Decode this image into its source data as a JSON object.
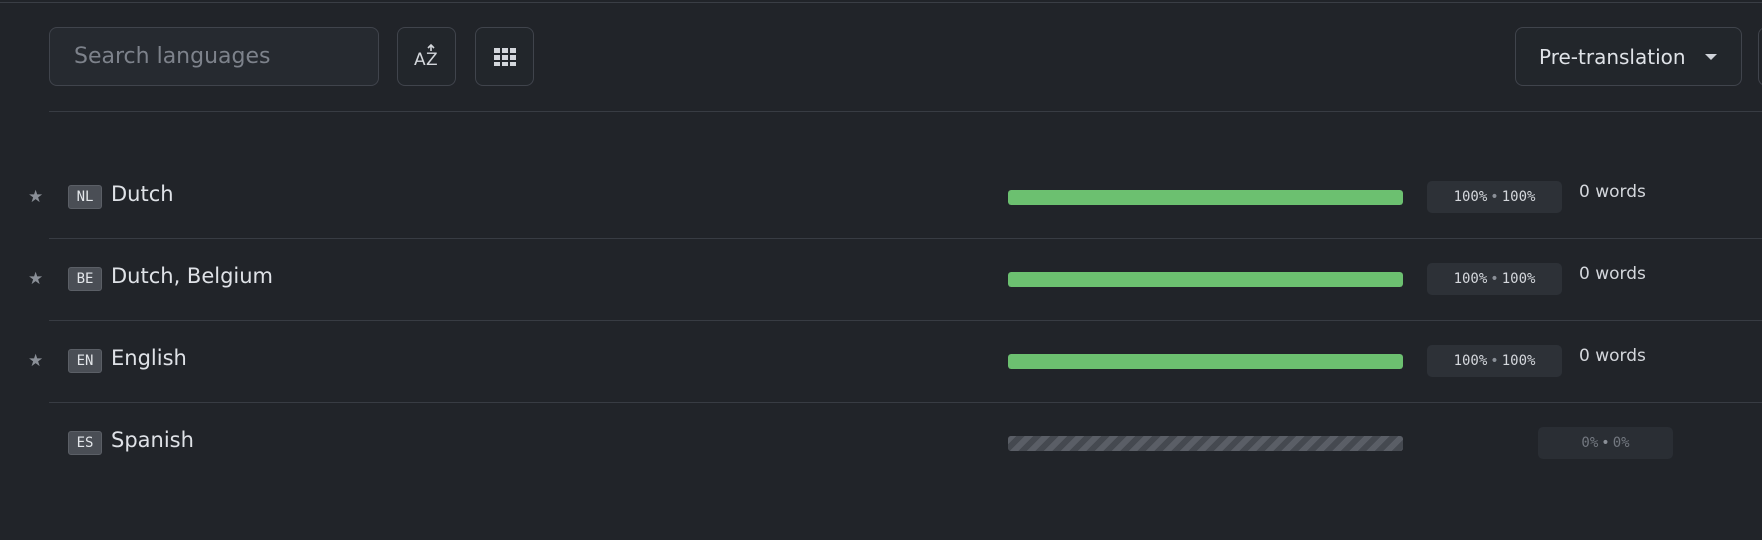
{
  "toolbar": {
    "search_placeholder": "Search languages",
    "sort_icon": "sort-az-icon",
    "grid_icon": "grid-view-icon",
    "dropdown_label": "Pre-translation"
  },
  "colors": {
    "background": "#212429",
    "progress_fill": "#6cc070",
    "code_badge": "#4a4e55"
  },
  "languages": [
    {
      "code": "NL",
      "name": "Dutch",
      "starred": true,
      "progress": 1.0,
      "stat_a": "100%",
      "stat_b": "100%",
      "words": "0 words"
    },
    {
      "code": "BE",
      "name": "Dutch, Belgium",
      "starred": true,
      "progress": 1.0,
      "stat_a": "100%",
      "stat_b": "100%",
      "words": "0 words"
    },
    {
      "code": "EN",
      "name": "English",
      "starred": true,
      "progress": 1.0,
      "stat_a": "100%",
      "stat_b": "100%",
      "words": "0 words"
    },
    {
      "code": "ES",
      "name": "Spanish",
      "starred": false,
      "progress": 0.0,
      "stat_a": "0%",
      "stat_b": "0%",
      "words": ""
    }
  ],
  "separator": "•",
  "star_symbol": "★"
}
